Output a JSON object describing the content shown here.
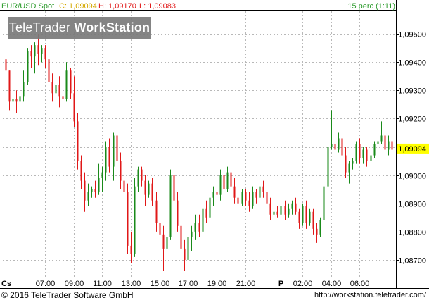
{
  "header": {
    "symbol": "EUR/USD Spot",
    "close_label": "C: 1,09094",
    "high_label": "H: 1,09170",
    "low_label": "L: 1,09083",
    "interval": "15 perc (1:11)"
  },
  "watermark": {
    "brand_light": "TeleTrader",
    "brand_bold": "WorkStation"
  },
  "footer": {
    "copyright": "© 2016 TeleTrader Software GmbH",
    "url": "http://workstation.teletrader.com/"
  },
  "colors": {
    "up": "#1a8a1a",
    "down": "#e01818",
    "grid": "#b8b8b8",
    "current_price_bg": "#ffff00",
    "header_text": "#2a9a2a",
    "header_values": "#e01818"
  },
  "chart_data": {
    "type": "candlestick",
    "title": "EUR/USD Spot",
    "interval": "15 perc (1:11)",
    "current_price": 1.09094,
    "current_price_label": "1,09094",
    "ylim": [
      1.0864,
      1.0958
    ],
    "y_ticks": [
      1.087,
      1.088,
      1.089,
      1.09,
      1.091,
      1.092,
      1.093,
      1.094,
      1.095
    ],
    "y_tick_labels": [
      "1,08700",
      "1,08800",
      "1,08900",
      "1,09000",
      "1,09100",
      "1,09200",
      "1,09300",
      "1,09400",
      "1,09500"
    ],
    "x_tick_labels": [
      "Cs",
      "07:00",
      "09:00",
      "11:00",
      "13:00",
      "15:00",
      "17:00",
      "19:00",
      "21:00",
      "P",
      "02:00",
      "04:00",
      "06:00"
    ],
    "grid": true,
    "candles": [
      [
        1.0941,
        1.0942,
        1.0935,
        1.0937
      ],
      [
        1.0937,
        1.0937,
        1.0923,
        1.0926
      ],
      [
        1.0926,
        1.0929,
        1.0923,
        1.0927
      ],
      [
        1.0927,
        1.093,
        1.0922,
        1.0926
      ],
      [
        1.0926,
        1.0933,
        1.0925,
        1.0928
      ],
      [
        1.0928,
        1.0937,
        1.0926,
        1.0933
      ],
      [
        1.0933,
        1.0945,
        1.0932,
        1.0944
      ],
      [
        1.0944,
        1.0946,
        1.0938,
        1.0942
      ],
      [
        1.0942,
        1.0947,
        1.0936,
        1.0946
      ],
      [
        1.0946,
        1.095,
        1.0939,
        1.0943
      ],
      [
        1.0943,
        1.0946,
        1.094,
        1.0945
      ],
      [
        1.0945,
        1.0946,
        1.0938,
        1.0941
      ],
      [
        1.0941,
        1.0943,
        1.093,
        1.0933
      ],
      [
        1.0933,
        1.0936,
        1.0926,
        1.0929
      ],
      [
        1.0929,
        1.0934,
        1.0927,
        1.0932
      ],
      [
        1.0932,
        1.0935,
        1.0924,
        1.0928
      ],
      [
        1.0928,
        1.0948,
        1.0919,
        1.0927
      ],
      [
        1.0927,
        1.094,
        1.0926,
        1.0937
      ],
      [
        1.0937,
        1.0938,
        1.0927,
        1.0929
      ],
      [
        1.0929,
        1.0935,
        1.0917,
        1.0919
      ],
      [
        1.0919,
        1.0922,
        1.0902,
        1.0905
      ],
      [
        1.0905,
        1.0907,
        1.0895,
        1.0898
      ],
      [
        1.0898,
        1.0901,
        1.0887,
        1.0891
      ],
      [
        1.0891,
        1.0897,
        1.0889,
        1.0894
      ],
      [
        1.0894,
        1.0896,
        1.0892,
        1.0895
      ],
      [
        1.0895,
        1.0898,
        1.0892,
        1.0894
      ],
      [
        1.0894,
        1.0904,
        1.0893,
        1.0899
      ],
      [
        1.0899,
        1.0903,
        1.0894,
        1.0901
      ],
      [
        1.0901,
        1.0912,
        1.0898,
        1.091
      ],
      [
        1.091,
        1.0913,
        1.0901,
        1.0903
      ],
      [
        1.0903,
        1.0915,
        1.0898,
        1.0914
      ],
      [
        1.0914,
        1.0915,
        1.0903,
        1.0905
      ],
      [
        1.0905,
        1.0908,
        1.0895,
        1.0898
      ],
      [
        1.0898,
        1.0903,
        1.0891,
        1.0894
      ],
      [
        1.0894,
        1.0897,
        1.0872,
        1.0875
      ],
      [
        1.0875,
        1.088,
        1.0869,
        1.0872
      ],
      [
        1.0872,
        1.0899,
        1.0871,
        1.0896
      ],
      [
        1.0896,
        1.0903,
        1.0894,
        1.0902
      ],
      [
        1.0902,
        1.0903,
        1.0896,
        1.0898
      ],
      [
        1.0898,
        1.09,
        1.0889,
        1.0893
      ],
      [
        1.0893,
        1.0898,
        1.0892,
        1.0897
      ],
      [
        1.0897,
        1.0899,
        1.0889,
        1.0891
      ],
      [
        1.0891,
        1.0894,
        1.088,
        1.0883
      ],
      [
        1.0883,
        1.0888,
        1.0876,
        1.0879
      ],
      [
        1.0879,
        1.0882,
        1.0866,
        1.0874
      ],
      [
        1.0874,
        1.088,
        1.0872,
        1.0878
      ],
      [
        1.0878,
        1.0902,
        1.0877,
        1.09
      ],
      [
        1.09,
        1.0903,
        1.0888,
        1.0891
      ],
      [
        1.0891,
        1.0894,
        1.088,
        1.0882
      ],
      [
        1.0882,
        1.0886,
        1.087,
        1.0874
      ],
      [
        1.0874,
        1.0877,
        1.0866,
        1.087
      ],
      [
        1.087,
        1.0879,
        1.0869,
        1.0878
      ],
      [
        1.0878,
        1.0882,
        1.0873,
        1.088
      ],
      [
        1.088,
        1.0886,
        1.0877,
        1.0883
      ],
      [
        1.0883,
        1.0886,
        1.0878,
        1.088
      ],
      [
        1.088,
        1.089,
        1.0879,
        1.0888
      ],
      [
        1.0888,
        1.0891,
        1.0883,
        1.0885
      ],
      [
        1.0885,
        1.0894,
        1.0884,
        1.0892
      ],
      [
        1.0892,
        1.0896,
        1.0889,
        1.0894
      ],
      [
        1.0894,
        1.0897,
        1.0891,
        1.0893
      ],
      [
        1.0893,
        1.0902,
        1.0891,
        1.09
      ],
      [
        1.09,
        1.0901,
        1.0893,
        1.0895
      ],
      [
        1.0895,
        1.0903,
        1.0894,
        1.0901
      ],
      [
        1.0901,
        1.0903,
        1.0894,
        1.0896
      ],
      [
        1.0896,
        1.0899,
        1.089,
        1.0892
      ],
      [
        1.0892,
        1.0894,
        1.0889,
        1.089
      ],
      [
        1.089,
        1.0895,
        1.0889,
        1.0894
      ],
      [
        1.0894,
        1.0895,
        1.0889,
        1.0891
      ],
      [
        1.0891,
        1.0894,
        1.0887,
        1.0889
      ],
      [
        1.0889,
        1.0896,
        1.0888,
        1.0894
      ],
      [
        1.0894,
        1.0895,
        1.089,
        1.0892
      ],
      [
        1.0892,
        1.0897,
        1.0891,
        1.0896
      ],
      [
        1.0896,
        1.0898,
        1.0892,
        1.0894
      ],
      [
        1.0894,
        1.0895,
        1.0888,
        1.089
      ],
      [
        1.089,
        1.0892,
        1.0884,
        1.0886
      ],
      [
        1.0886,
        1.0888,
        1.0884,
        1.0887
      ],
      [
        1.0887,
        1.0889,
        1.0885,
        1.0886
      ],
      [
        1.0886,
        1.089,
        1.0885,
        1.0889
      ],
      [
        1.0889,
        1.0891,
        1.0884,
        1.0886
      ],
      [
        1.0886,
        1.089,
        1.0885,
        1.0888
      ],
      [
        1.0888,
        1.0891,
        1.0886,
        1.089
      ],
      [
        1.089,
        1.0892,
        1.0886,
        1.0887
      ],
      [
        1.0887,
        1.0888,
        1.0881,
        1.0883
      ],
      [
        1.0883,
        1.089,
        1.0882,
        1.0889
      ],
      [
        1.0889,
        1.0891,
        1.0881,
        1.0883
      ],
      [
        1.0883,
        1.0888,
        1.0882,
        1.0887
      ],
      [
        1.0887,
        1.0888,
        1.0879,
        1.0881
      ],
      [
        1.0881,
        1.0883,
        1.0876,
        1.0879
      ],
      [
        1.0879,
        1.0885,
        1.0878,
        1.0884
      ],
      [
        1.0884,
        1.0898,
        1.0883,
        1.0896
      ],
      [
        1.0896,
        1.0912,
        1.0895,
        1.091
      ],
      [
        1.091,
        1.0923,
        1.0909,
        1.0911
      ],
      [
        1.0911,
        1.0913,
        1.0907,
        1.0909
      ],
      [
        1.0909,
        1.0915,
        1.0908,
        1.0913
      ],
      [
        1.0913,
        1.0914,
        1.0905,
        1.0907
      ],
      [
        1.0907,
        1.091,
        1.0899,
        1.0901
      ],
      [
        1.0901,
        1.0905,
        1.0897,
        1.0904
      ],
      [
        1.0904,
        1.0906,
        1.0902,
        1.0905
      ],
      [
        1.0905,
        1.0912,
        1.0904,
        1.0911
      ],
      [
        1.0911,
        1.0913,
        1.0904,
        1.0906
      ],
      [
        1.0906,
        1.091,
        1.0904,
        1.0909
      ],
      [
        1.0909,
        1.091,
        1.0903,
        1.0905
      ],
      [
        1.0905,
        1.0908,
        1.0903,
        1.0907
      ],
      [
        1.0907,
        1.0912,
        1.0906,
        1.0911
      ],
      [
        1.0911,
        1.0914,
        1.0909,
        1.0912
      ],
      [
        1.0912,
        1.0919,
        1.0911,
        1.0914
      ],
      [
        1.0914,
        1.0916,
        1.0907,
        1.0909
      ],
      [
        1.0909,
        1.0914,
        1.0907,
        1.0912
      ],
      [
        1.0912,
        1.0917,
        1.0906,
        1.0909
      ]
    ]
  }
}
